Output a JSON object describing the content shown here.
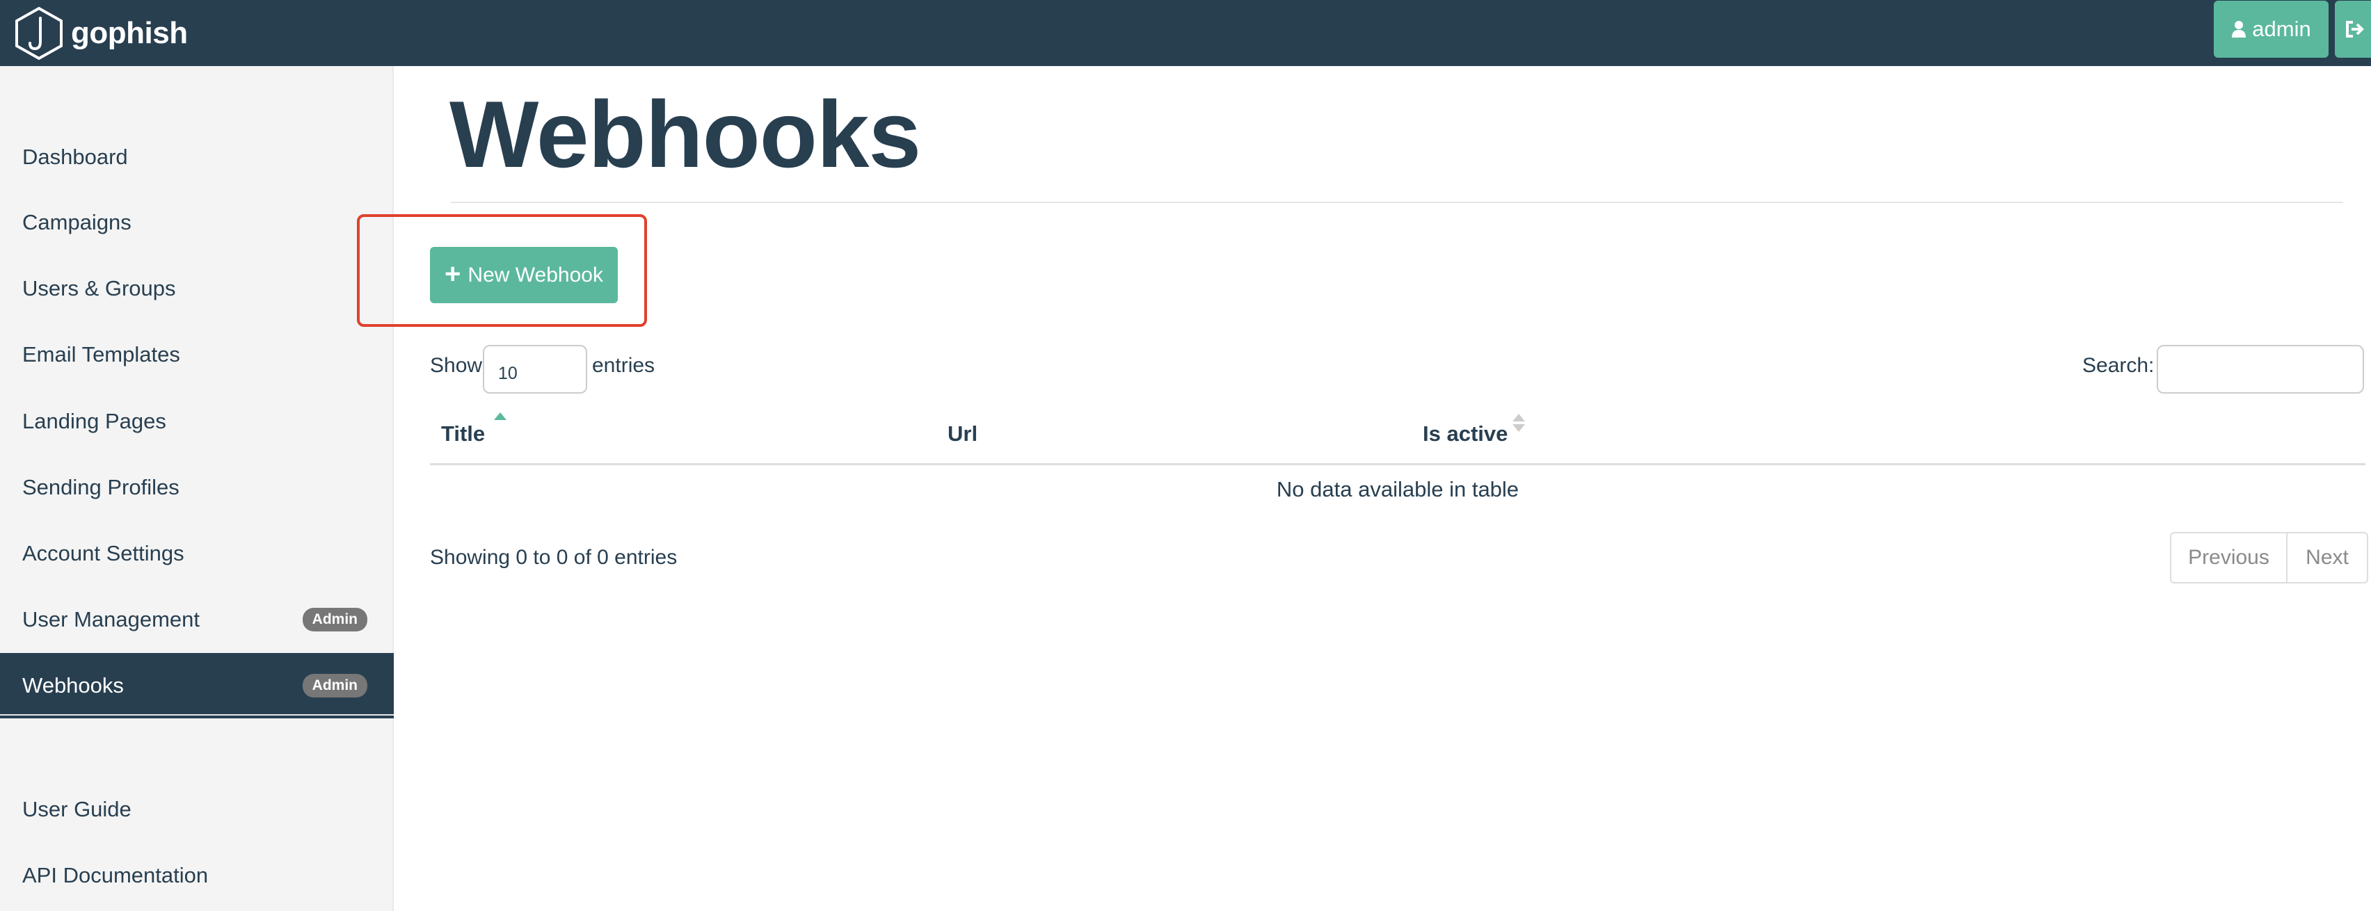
{
  "brand": {
    "name": "gophish",
    "logo_icon": "gophish-hook-logo"
  },
  "navbar": {
    "user_label": "admin",
    "user_icon": "user-icon",
    "logout_icon": "sign-out-icon"
  },
  "sidebar": {
    "items": [
      {
        "label": "Dashboard"
      },
      {
        "label": "Campaigns"
      },
      {
        "label": "Users & Groups"
      },
      {
        "label": "Email Templates"
      },
      {
        "label": "Landing Pages"
      },
      {
        "label": "Sending Profiles"
      },
      {
        "label": "Account Settings"
      },
      {
        "label": "User Management",
        "badge": "Admin"
      },
      {
        "label": "Webhooks",
        "badge": "Admin",
        "active": true
      }
    ],
    "secondary": [
      {
        "label": "User Guide"
      },
      {
        "label": "API Documentation"
      }
    ]
  },
  "page": {
    "title": "Webhooks"
  },
  "toolbar": {
    "new_label": "New Webhook"
  },
  "table": {
    "length_prefix": "Show",
    "length_value": "10",
    "length_suffix": "entries",
    "search_label": "Search:",
    "search_value": "",
    "columns": [
      "Title",
      "Url",
      "Is active"
    ],
    "empty_text": "No data available in table",
    "info": "Showing 0 to 0 of 0 entries",
    "pagination": {
      "previous": "Previous",
      "next": "Next"
    }
  },
  "colors": {
    "navbar": "#283f50",
    "accent": "#5bb89d",
    "highlight": "#e0412e",
    "sidebar_bg": "#f4f4f4"
  }
}
